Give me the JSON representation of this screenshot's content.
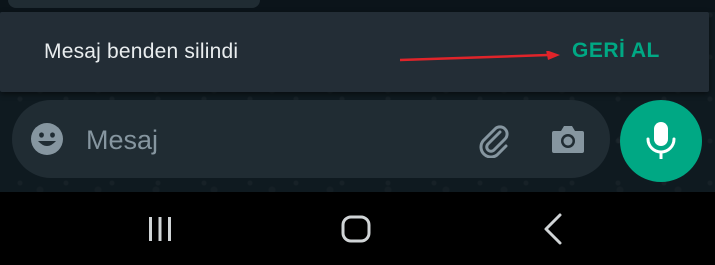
{
  "snackbar": {
    "message": "Mesaj benden silindi",
    "action_label": "GERİ AL",
    "arrow_color": "#e0242a"
  },
  "composer": {
    "value": "",
    "placeholder": "Mesaj",
    "icons": [
      "emoji-icon",
      "attach-icon",
      "camera-icon"
    ]
  },
  "mic": {
    "icon": "mic-icon",
    "color": "#00a884"
  },
  "navbar": {
    "icons": [
      "recent-apps-icon",
      "home-icon",
      "back-icon"
    ]
  },
  "colors": {
    "background": "#0b141a",
    "snackbar": "#232d36",
    "composer": "#202c33",
    "accent": "#00a884"
  }
}
